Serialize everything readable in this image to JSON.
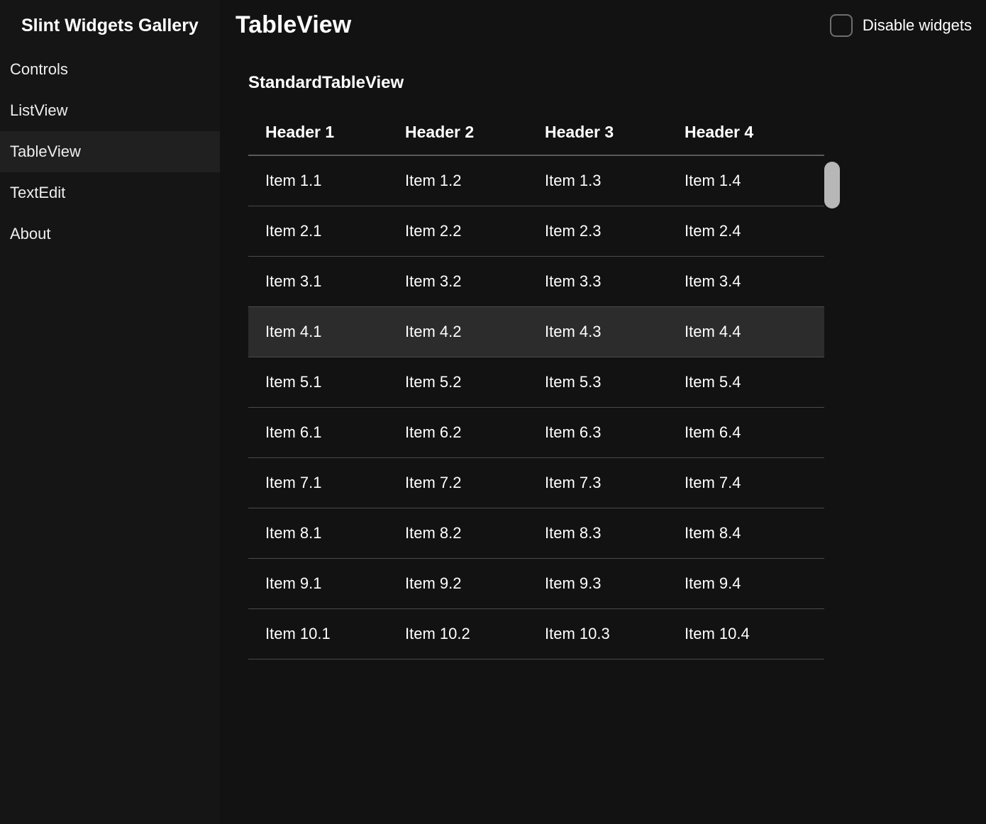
{
  "app_title": "Slint Widgets Gallery",
  "sidebar": {
    "items": [
      {
        "label": "Controls",
        "active": false
      },
      {
        "label": "ListView",
        "active": false
      },
      {
        "label": "TableView",
        "active": true
      },
      {
        "label": "TextEdit",
        "active": false
      },
      {
        "label": "About",
        "active": false
      }
    ]
  },
  "header": {
    "title": "TableView",
    "disable_label": "Disable widgets",
    "disable_checked": false
  },
  "section_title": "StandardTableView",
  "table": {
    "headers": [
      "Header 1",
      "Header 2",
      "Header 3",
      "Header 4"
    ],
    "rows": [
      {
        "cells": [
          "Item 1.1",
          "Item 1.2",
          "Item 1.3",
          "Item 1.4"
        ],
        "highlight": false
      },
      {
        "cells": [
          "Item 2.1",
          "Item 2.2",
          "Item 2.3",
          "Item 2.4"
        ],
        "highlight": false
      },
      {
        "cells": [
          "Item 3.1",
          "Item 3.2",
          "Item 3.3",
          "Item 3.4"
        ],
        "highlight": false
      },
      {
        "cells": [
          "Item 4.1",
          "Item 4.2",
          "Item 4.3",
          "Item 4.4"
        ],
        "highlight": true
      },
      {
        "cells": [
          "Item 5.1",
          "Item 5.2",
          "Item 5.3",
          "Item 5.4"
        ],
        "highlight": false
      },
      {
        "cells": [
          "Item 6.1",
          "Item 6.2",
          "Item 6.3",
          "Item 6.4"
        ],
        "highlight": false
      },
      {
        "cells": [
          "Item 7.1",
          "Item 7.2",
          "Item 7.3",
          "Item 7.4"
        ],
        "highlight": false
      },
      {
        "cells": [
          "Item 8.1",
          "Item 8.2",
          "Item 8.3",
          "Item 8.4"
        ],
        "highlight": false
      },
      {
        "cells": [
          "Item 9.1",
          "Item 9.2",
          "Item 9.3",
          "Item 9.4"
        ],
        "highlight": false
      },
      {
        "cells": [
          "Item 10.1",
          "Item 10.2",
          "Item 10.3",
          "Item 10.4"
        ],
        "highlight": false
      }
    ]
  }
}
